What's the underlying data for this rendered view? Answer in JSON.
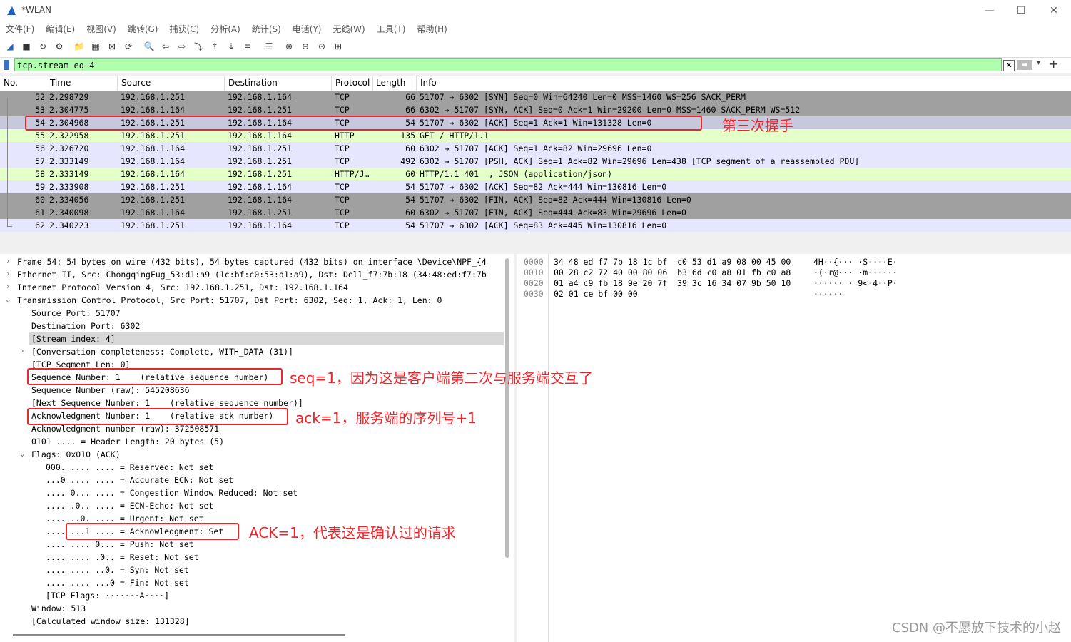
{
  "window": {
    "title": "*WLAN"
  },
  "menu": [
    "文件(F)",
    "编辑(E)",
    "视图(V)",
    "跳转(G)",
    "捕获(C)",
    "分析(A)",
    "统计(S)",
    "电话(Y)",
    "无线(W)",
    "工具(T)",
    "帮助(H)"
  ],
  "toolbar_icons": [
    "shark-fin-start-icon",
    "stop-icon",
    "restart-icon",
    "options-gear-icon",
    "open-folder-icon",
    "save-file-icon",
    "close-file-icon",
    "reload-icon",
    "find-icon",
    "back-arrow-icon",
    "forward-arrow-icon",
    "go-to-packet-icon",
    "first-packet-icon",
    "last-packet-icon",
    "auto-scroll-icon",
    "colorize-icon",
    "zoom-in-icon",
    "zoom-out-icon",
    "normal-size-icon",
    "resize-columns-icon"
  ],
  "filter": {
    "value": "tcp.stream eq 4"
  },
  "columns": [
    "No.",
    "Time",
    "Source",
    "Destination",
    "Protocol",
    "Length",
    "Info"
  ],
  "packets": [
    {
      "no": "52",
      "time": "2.298729",
      "src": "192.168.1.251",
      "dst": "192.168.1.164",
      "proto": "TCP",
      "len": "66",
      "info": "51707 → 6302 [SYN] Seq=0 Win=64240 Len=0 MSS=1460 WS=256 SACK_PERM",
      "bg": "#a0a0a0"
    },
    {
      "no": "53",
      "time": "2.304775",
      "src": "192.168.1.164",
      "dst": "192.168.1.251",
      "proto": "TCP",
      "len": "66",
      "info": "6302 → 51707 [SYN, ACK] Seq=0 Ack=1 Win=29200 Len=0 MSS=1460 SACK_PERM WS=512",
      "bg": "#a0a0a0"
    },
    {
      "no": "54",
      "time": "2.304968",
      "src": "192.168.1.251",
      "dst": "192.168.1.164",
      "proto": "TCP",
      "len": "54",
      "info": "51707 → 6302 [ACK] Seq=1 Ack=1 Win=131328 Len=0",
      "bg": "#c8c8dc"
    },
    {
      "no": "55",
      "time": "2.322958",
      "src": "192.168.1.251",
      "dst": "192.168.1.164",
      "proto": "HTTP",
      "len": "135",
      "info": "GET / HTTP/1.1",
      "bg": "#e4ffc7"
    },
    {
      "no": "56",
      "time": "2.326720",
      "src": "192.168.1.164",
      "dst": "192.168.1.251",
      "proto": "TCP",
      "len": "60",
      "info": "6302 → 51707 [ACK] Seq=1 Ack=82 Win=29696 Len=0",
      "bg": "#e7e6ff"
    },
    {
      "no": "57",
      "time": "2.333149",
      "src": "192.168.1.164",
      "dst": "192.168.1.251",
      "proto": "TCP",
      "len": "492",
      "info": "6302 → 51707 [PSH, ACK] Seq=1 Ack=82 Win=29696 Len=438 [TCP segment of a reassembled PDU]",
      "bg": "#e7e6ff"
    },
    {
      "no": "58",
      "time": "2.333149",
      "src": "192.168.1.164",
      "dst": "192.168.1.251",
      "proto": "HTTP/J…",
      "len": "60",
      "info": "HTTP/1.1 401  , JSON (application/json)",
      "bg": "#e4ffc7"
    },
    {
      "no": "59",
      "time": "2.333908",
      "src": "192.168.1.251",
      "dst": "192.168.1.164",
      "proto": "TCP",
      "len": "54",
      "info": "51707 → 6302 [ACK] Seq=82 Ack=444 Win=130816 Len=0",
      "bg": "#e7e6ff"
    },
    {
      "no": "60",
      "time": "2.334056",
      "src": "192.168.1.251",
      "dst": "192.168.1.164",
      "proto": "TCP",
      "len": "54",
      "info": "51707 → 6302 [FIN, ACK] Seq=82 Ack=444 Win=130816 Len=0",
      "bg": "#a0a0a0"
    },
    {
      "no": "61",
      "time": "2.340098",
      "src": "192.168.1.164",
      "dst": "192.168.1.251",
      "proto": "TCP",
      "len": "60",
      "info": "6302 → 51707 [FIN, ACK] Seq=444 Ack=83 Win=29696 Len=0",
      "bg": "#a0a0a0"
    },
    {
      "no": "62",
      "time": "2.340223",
      "src": "192.168.1.251",
      "dst": "192.168.1.164",
      "proto": "TCP",
      "len": "54",
      "info": "51707 → 6302 [ACK] Seq=83 Ack=445 Win=130816 Len=0",
      "bg": "#e7e6ff"
    }
  ],
  "details": [
    {
      "text": "Frame 54: 54 bytes on wire (432 bits), 54 bytes captured (432 bits) on interface \\Device\\NPF_{4",
      "twisty": "›"
    },
    {
      "text": "Ethernet II, Src: ChongqingFug_53:d1:a9 (1c:bf:c0:53:d1:a9), Dst: Dell_f7:7b:18 (34:48:ed:f7:7b",
      "twisty": "›"
    },
    {
      "text": "Internet Protocol Version 4, Src: 192.168.1.251, Dst: 192.168.1.164",
      "twisty": "›"
    },
    {
      "text": "Transmission Control Protocol, Src Port: 51707, Dst Port: 6302, Seq: 1, Ack: 1, Len: 0",
      "twisty": "⌄"
    },
    {
      "text": "Source Port: 51707",
      "twisty": ""
    },
    {
      "text": "Destination Port: 6302",
      "twisty": ""
    },
    {
      "text": "[Stream index: 4]",
      "twisty": ""
    },
    {
      "text": "[Conversation completeness: Complete, WITH_DATA (31)]",
      "twisty": "›"
    },
    {
      "text": "[TCP Segment Len: 0]",
      "twisty": ""
    },
    {
      "text": "Sequence Number: 1    (relative sequence number)",
      "twisty": ""
    },
    {
      "text": "Sequence Number (raw): 545208636",
      "twisty": ""
    },
    {
      "text": "[Next Sequence Number: 1    (relative sequence number)]",
      "twisty": ""
    },
    {
      "text": "Acknowledgment Number: 1    (relative ack number)",
      "twisty": ""
    },
    {
      "text": "Acknowledgment number (raw): 372508571",
      "twisty": ""
    },
    {
      "text": "0101 .... = Header Length: 20 bytes (5)",
      "twisty": ""
    },
    {
      "text": "Flags: 0x010 (ACK)",
      "twisty": "⌄"
    },
    {
      "text": "000. .... .... = Reserved: Not set",
      "twisty": ""
    },
    {
      "text": "...0 .... .... = Accurate ECN: Not set",
      "twisty": ""
    },
    {
      "text": ".... 0... .... = Congestion Window Reduced: Not set",
      "twisty": ""
    },
    {
      "text": ".... .0.. .... = ECN-Echo: Not set",
      "twisty": ""
    },
    {
      "text": ".... ..0. .... = Urgent: Not set",
      "twisty": ""
    },
    {
      "text": ".... ...1 .... = Acknowledgment: Set",
      "twisty": ""
    },
    {
      "text": ".... .... 0... = Push: Not set",
      "twisty": ""
    },
    {
      "text": ".... .... .0.. = Reset: Not set",
      "twisty": ""
    },
    {
      "text": ".... .... ..0. = Syn: Not set",
      "twisty": ""
    },
    {
      "text": ".... .... ...0 = Fin: Not set",
      "twisty": ""
    },
    {
      "text": "[TCP Flags: ·······A····]",
      "twisty": ""
    },
    {
      "text": "Window: 513",
      "twisty": ""
    },
    {
      "text": "[Calculated window size: 131328]",
      "twisty": ""
    }
  ],
  "hex": [
    {
      "offset": "0000",
      "bytes": "34 48 ed f7 7b 18 1c bf  c0 53 d1 a9 08 00 45 00",
      "ascii": "4H··{··· ·S····E·"
    },
    {
      "offset": "0010",
      "bytes": "00 28 c2 72 40 00 80 06  b3 6d c0 a8 01 fb c0 a8",
      "ascii": "·(·r@··· ·m······"
    },
    {
      "offset": "0020",
      "bytes": "01 a4 c9 fb 18 9e 20 7f  39 3c 16 34 07 9b 50 10",
      "ascii": "······ · 9<·4··P·"
    },
    {
      "offset": "0030",
      "bytes": "02 01 ce bf 00 00",
      "ascii": "······"
    }
  ],
  "annotations": {
    "third_handshake": "第三次握手",
    "seq": "seq=1，因为这是客户端第二次与服务端交互了",
    "ack": "ack=1，服务端的序列号+1",
    "ack_flag": "ACK=1，代表这是确认过的请求"
  },
  "watermark": "CSDN @不愿放下技术的小赵",
  "colors": {
    "annotation_red": "#e8262c",
    "filter_green": "#afffaf"
  }
}
